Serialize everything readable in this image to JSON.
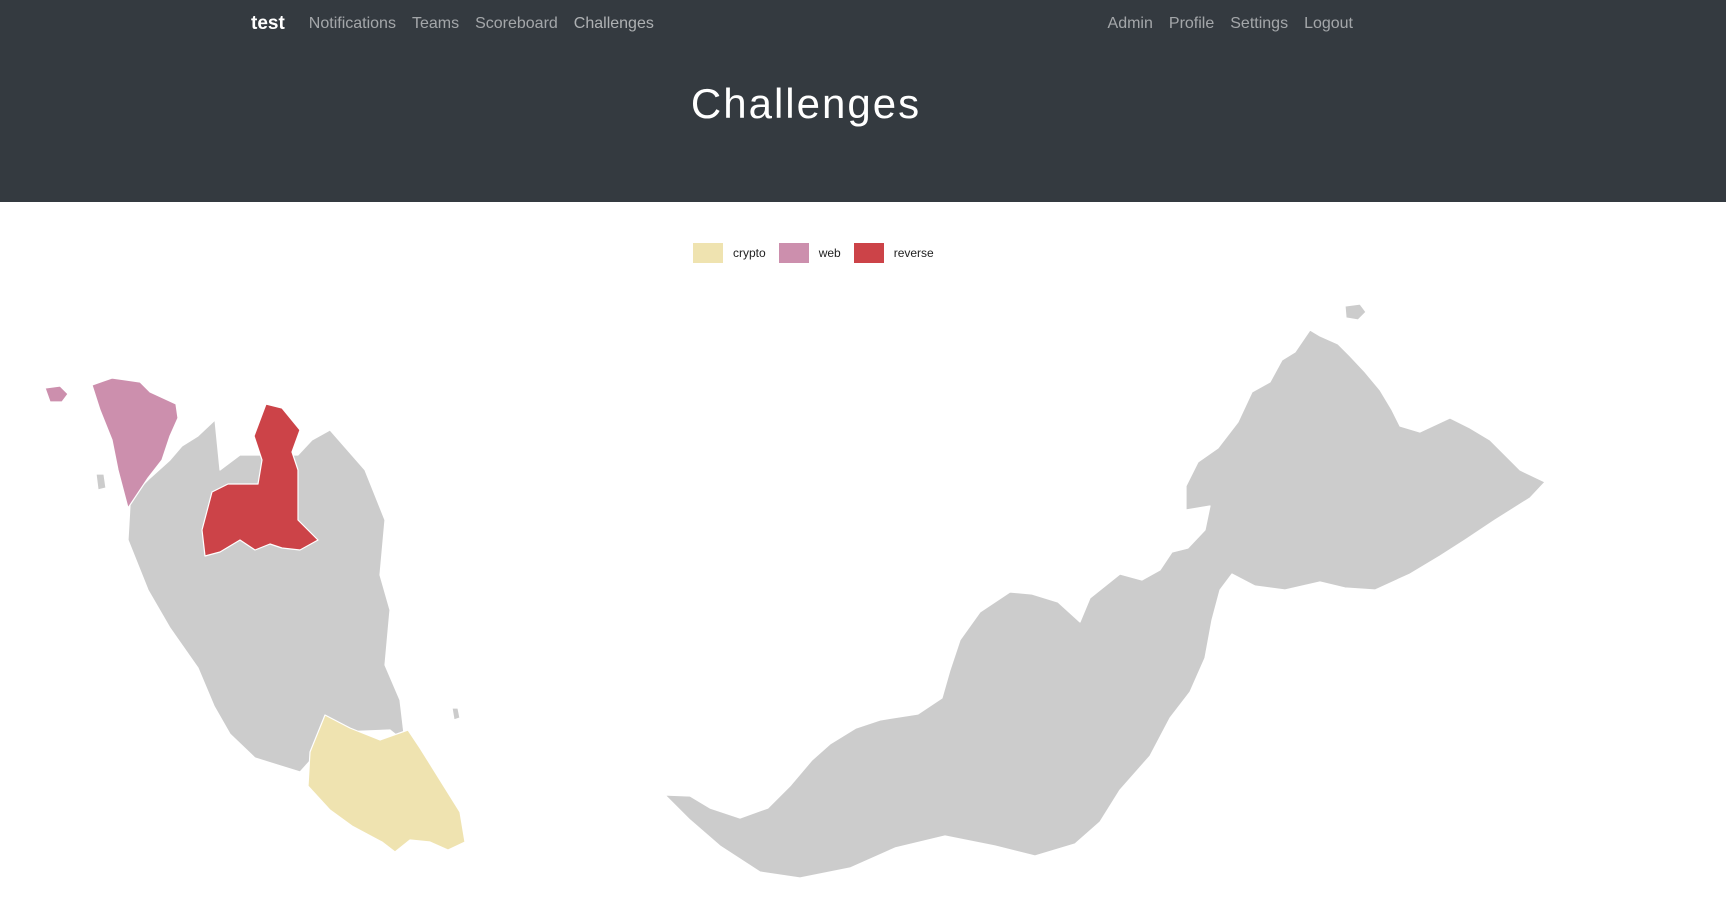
{
  "nav": {
    "brand": "test",
    "left_links": [
      "Notifications",
      "Teams",
      "Scoreboard",
      "Challenges"
    ],
    "right_links": [
      "Admin",
      "Profile",
      "Settings",
      "Logout"
    ]
  },
  "header": {
    "title": "Challenges"
  },
  "legend": [
    {
      "label": "crypto",
      "color": "#efe3b0"
    },
    {
      "label": "web",
      "color": "#cc8fad"
    },
    {
      "label": "reverse",
      "color": "#cc4348"
    }
  ],
  "map": {
    "default_color": "#cccccc",
    "highlighted_regions": [
      {
        "region": "Kedah",
        "category": "web",
        "color": "#cc8fad"
      },
      {
        "region": "Perlis",
        "category": "web",
        "color": "#cc8fad"
      },
      {
        "region": "Kelantan",
        "category": "reverse",
        "color": "#cc4348"
      },
      {
        "region": "Johor",
        "category": "crypto",
        "color": "#efe3b0"
      }
    ]
  }
}
